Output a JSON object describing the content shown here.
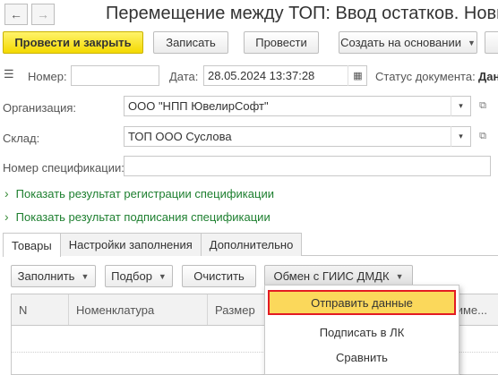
{
  "window": {
    "back_icon": "arrow-left-icon",
    "forward_icon": "arrow-right-icon",
    "title": "Перемещение между ТОП: Ввод остатков. Новый"
  },
  "toolbar": {
    "post_close": "Провести и закрыть",
    "save": "Записать",
    "post": "Провести",
    "create_based": "Создать на основании"
  },
  "header_fields": {
    "number_label": "Номер:",
    "number_value": "",
    "date_label": "Дата:",
    "date_value": "28.05.2024 13:37:28",
    "status_label": "Статус документа:",
    "status_value": "Дан"
  },
  "form": {
    "org_label": "Организация:",
    "org_value": "ООО \"НПП ЮвелирСофт\"",
    "warehouse_label": "Склад:",
    "warehouse_value": "ТОП ООО Суслова",
    "spec_label": "Номер спецификации:",
    "spec_value": ""
  },
  "links": {
    "reg_result": "Показать результат регистрации спецификации",
    "sign_result": "Показать результат подписания спецификации"
  },
  "tabs": [
    "Товары",
    "Настройки заполнения",
    "Дополнительно"
  ],
  "table_toolbar": {
    "fill": "Заполнить",
    "pick": "Подбор",
    "clear": "Очистить",
    "exchange": "Обмен с ГИИС ДМДК"
  },
  "table": {
    "columns": [
      "N",
      "Номенклатура",
      "Размер",
      "име..."
    ]
  },
  "dropdown_menu": {
    "items": [
      "Отправить данные",
      "Подписать в ЛК",
      "Сравнить"
    ],
    "selected_index": 0,
    "highlight_color": "#fbd85b",
    "outline_color": "#e31b23"
  },
  "colors": {
    "primary_button": "#f4d900",
    "link": "#1d7f2f"
  }
}
